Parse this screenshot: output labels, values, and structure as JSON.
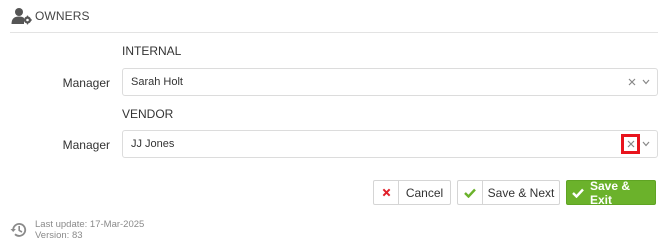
{
  "section": {
    "title": "OWNERS",
    "icon": "owners-user-gear-icon"
  },
  "internal": {
    "heading": "INTERNAL",
    "manager_label": "Manager",
    "manager_value": "Sarah Holt"
  },
  "vendor": {
    "heading": "VENDOR",
    "manager_label": "Manager",
    "manager_value": "JJ Jones"
  },
  "actions": {
    "cancel_label": "Cancel",
    "save_next_label": "Save & Next",
    "save_exit_label": "Save & Exit"
  },
  "footer": {
    "last_update": "Last update: 17-Mar-2025",
    "version": "Version: 83"
  },
  "colors": {
    "primary_green": "#6bb22b",
    "cancel_red": "#e0202a",
    "highlight_red": "#e8141d"
  }
}
